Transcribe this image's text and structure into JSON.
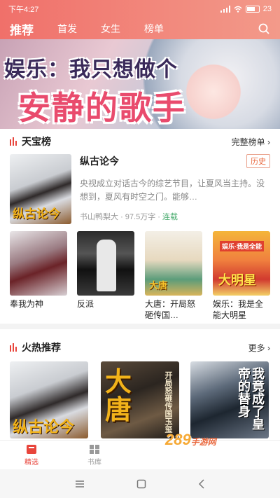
{
  "status_bar": {
    "time": "下午4:27",
    "battery": "23"
  },
  "top_nav": {
    "tabs": [
      {
        "label": "推荐",
        "active": true
      },
      {
        "label": "首发",
        "active": false
      },
      {
        "label": "女生",
        "active": false
      },
      {
        "label": "榜单",
        "active": false
      }
    ],
    "search_icon": "search-icon"
  },
  "banner": {
    "line1": "娱乐：我只想做个",
    "line2": "安静的歌手"
  },
  "tianbao": {
    "title": "天宝榜",
    "more": "完整榜单 ›",
    "featured": {
      "name": "纵古论今",
      "badge": "历史",
      "desc": "央视成立对话古今的综艺节目，让夏风当主持。没想到，夏风有时空之门。能够…",
      "author": "书山鸭梨大",
      "words": "97.5万字",
      "status": "连载",
      "cover_text": "纵古论今"
    },
    "books": [
      {
        "name": "奉我为神"
      },
      {
        "name": "反派"
      },
      {
        "name": "大唐：开局怒砸传国…",
        "cover_text": "大唐"
      },
      {
        "name": "娱乐：我是全能大明星",
        "cover_text": "大明星",
        "cover_tag": "娱乐·我是全能"
      }
    ]
  },
  "hot": {
    "title": "火热推荐",
    "more": "更多 ›",
    "books": [
      {
        "cover_text": "纵古论今"
      },
      {
        "cover_text": "大唐",
        "cover_sub": "开局怒砸传国玉玺"
      },
      {
        "cover_text": "我竟成了皇帝的替身"
      }
    ]
  },
  "bottom_nav": {
    "items": [
      {
        "label": "精选",
        "active": true,
        "icon": "featured-icon"
      },
      {
        "label": "书库",
        "active": false,
        "icon": "library-icon"
      }
    ]
  },
  "watermark": {
    "text": "289",
    "sub": "手游网"
  }
}
